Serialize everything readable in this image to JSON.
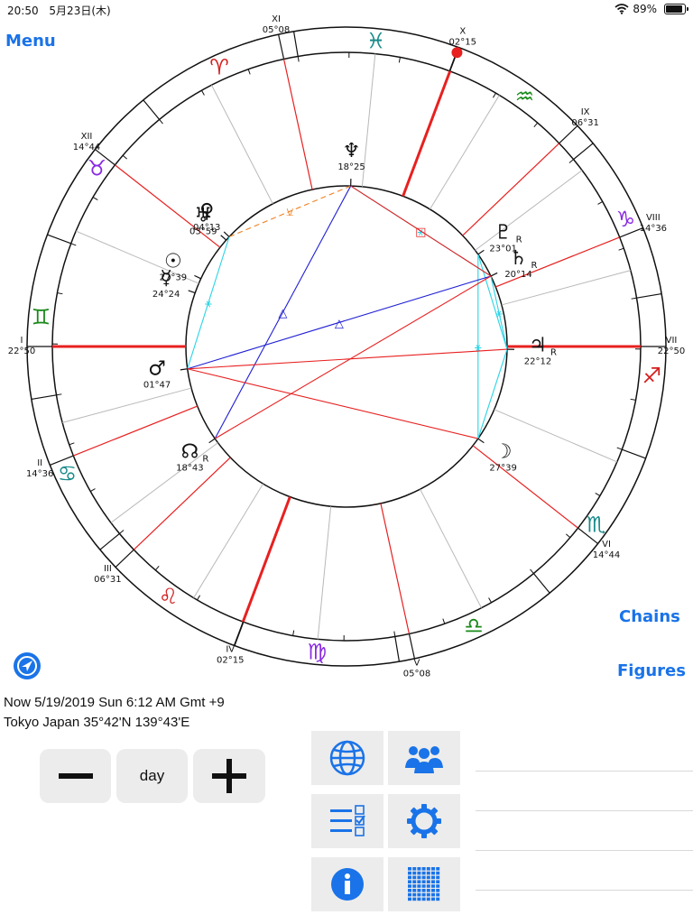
{
  "status_bar": {
    "time": "20:50",
    "date": "5月23日(木)",
    "battery": "89%",
    "battery_level": 0.89
  },
  "nav": {
    "menu_label": "Menu",
    "chains_label": "Chains",
    "figures_label": "Figures"
  },
  "chart": {
    "houses": [
      {
        "numeral": "I",
        "degree": "22°50",
        "asc": 180.0
      },
      {
        "numeral": "II",
        "degree": "14°36",
        "asc": 201.8
      },
      {
        "numeral": "III",
        "degree": "06°31",
        "asc": 223.7
      },
      {
        "numeral": "IV",
        "degree": "02°15",
        "asc": 249.4
      },
      {
        "numeral": "V",
        "degree": "05°08",
        "asc": 282.3
      },
      {
        "numeral": "VI",
        "degree": "14°44",
        "asc": 321.9
      },
      {
        "numeral": "VII",
        "degree": "22°50",
        "asc": 0.0
      },
      {
        "numeral": "VIII",
        "degree": "14°36",
        "asc": 21.8
      },
      {
        "numeral": "IX",
        "degree": "06°31",
        "asc": 43.7
      },
      {
        "numeral": "X",
        "degree": "02°15",
        "asc": 69.4
      },
      {
        "numeral": "XI",
        "degree": "05°08",
        "asc": 102.3
      },
      {
        "numeral": "XII",
        "degree": "14°44",
        "asc": 141.9
      }
    ],
    "signs": [
      {
        "glyph": "♈",
        "asc": 114.5,
        "color": "#d42020"
      },
      {
        "glyph": "♉",
        "asc": 144.5,
        "color": "#8a2be2"
      },
      {
        "glyph": "♊",
        "asc": 174.5,
        "color": "#1a8a1a"
      },
      {
        "glyph": "♋",
        "asc": 204.5,
        "color": "#1a8a8a"
      },
      {
        "glyph": "♌",
        "asc": 234.5,
        "color": "#d42020"
      },
      {
        "glyph": "♍",
        "asc": 264.5,
        "color": "#8a2be2"
      },
      {
        "glyph": "♎",
        "asc": 294.5,
        "color": "#1a8a1a"
      },
      {
        "glyph": "♏",
        "asc": 324.5,
        "color": "#1a8a8a"
      },
      {
        "glyph": "♐",
        "asc": 354.5,
        "color": "#d42020"
      },
      {
        "glyph": "♑",
        "asc": 24.5,
        "color": "#8a2be2"
      },
      {
        "glyph": "♒",
        "asc": 54.5,
        "color": "#1a8a1a"
      },
      {
        "glyph": "♓",
        "asc": 84.5,
        "color": "#1a8a8a"
      }
    ],
    "planets": [
      {
        "glyph": "♅",
        "degree": "03°59",
        "asc": 138.5,
        "retro": false
      },
      {
        "glyph": "♀",
        "degree": "04°13",
        "asc": 136.9,
        "retro": false
      },
      {
        "glyph": "♆",
        "degree": "18°25",
        "asc": 88.5,
        "retro": false
      },
      {
        "glyph": "♇",
        "degree": "23°01",
        "asc": 35.0,
        "retro": true
      },
      {
        "glyph": "♄",
        "degree": "20°14",
        "asc": 26.0,
        "retro": true
      },
      {
        "glyph": "♃",
        "degree": "22°12",
        "asc": -1.0,
        "retro": true
      },
      {
        "glyph": "☽",
        "degree": "27°39",
        "asc": -35.0,
        "retro": false
      },
      {
        "glyph": "☿",
        "degree": "24°24",
        "asc": 160.5,
        "retro": false
      },
      {
        "glyph": "☉",
        "degree": "27°39",
        "asc": 155.0,
        "retro": false
      },
      {
        "glyph": "♂",
        "degree": "01°47",
        "asc": 188.0,
        "retro": false
      },
      {
        "glyph": "☊",
        "degree": "18°43",
        "asc": 215.0,
        "retro": true
      }
    ],
    "aspects": [
      {
        "a": 6,
        "b": 3,
        "color": "#2ad4e6",
        "glyph": "⚹"
      },
      {
        "a": 4,
        "b": 5,
        "color": "#2ad4e6",
        "glyph": "⚹"
      },
      {
        "a": 2,
        "b": 4,
        "color": "#2ad4e6",
        "glyph": "⚹"
      },
      {
        "a": 1,
        "b": 9,
        "color": "#2ad4e6",
        "glyph": "⚹"
      },
      {
        "a": 5,
        "b": 6,
        "color": "#2ad4e6",
        "glyph": ""
      },
      {
        "a": 3,
        "b": 5,
        "color": "#2ad4e6",
        "glyph": ""
      },
      {
        "a": 1,
        "b": 2,
        "color": "#f08020",
        "glyph": "⚺"
      },
      {
        "a": 9,
        "b": 4,
        "color": "#2020d4",
        "glyph": "△"
      },
      {
        "a": 10,
        "b": 2,
        "color": "#2020d4",
        "glyph": "△"
      },
      {
        "a": 9,
        "b": 6,
        "color": "#e82020",
        "glyph": ""
      },
      {
        "a": 10,
        "b": 4,
        "color": "#e82020",
        "glyph": ""
      },
      {
        "a": 9,
        "b": 5,
        "color": "#e82020",
        "glyph": ""
      },
      {
        "a": 2,
        "b": 4,
        "color": "#e82020",
        "glyph": "□"
      }
    ],
    "retro_mark": "R"
  },
  "info": {
    "now": "Now 5/19/2019 Sun 6:12 AM Gmt +9",
    "place": "Tokyo Japan  35°42'N 139°43'E"
  },
  "controls": {
    "step_label": "day"
  },
  "icons": {
    "locate": "locate-icon",
    "globe": "globe-icon",
    "people": "people-icon",
    "list": "list-check-icon",
    "gear": "gear-icon",
    "info": "info-icon",
    "grid": "grid-icon"
  },
  "colors": {
    "accent": "#1a73e8",
    "house_cusp": "#e82020",
    "tile_bg": "#ececec"
  }
}
